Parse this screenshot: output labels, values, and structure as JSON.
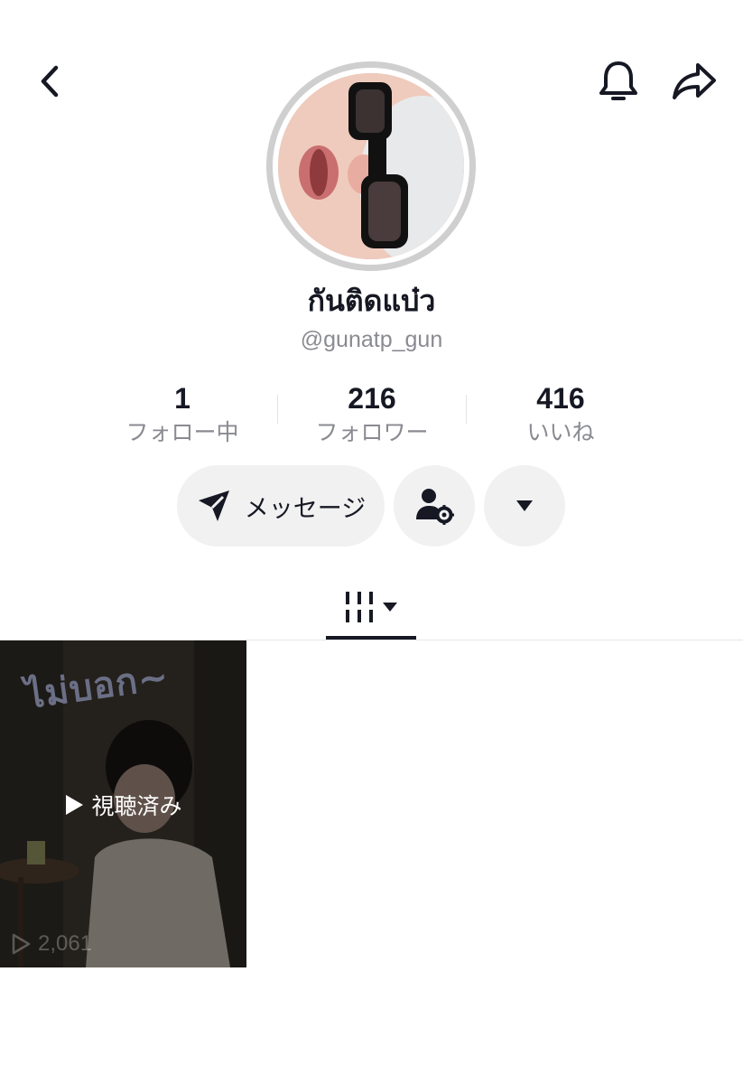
{
  "profile": {
    "display_name": "กันติดแบ๋ว",
    "username": "@gunatp_gun"
  },
  "stats": [
    {
      "value": "1",
      "label": "フォロー中"
    },
    {
      "value": "216",
      "label": "フォロワー"
    },
    {
      "value": "416",
      "label": "いいね"
    }
  ],
  "actions": {
    "message_label": "メッセージ"
  },
  "videos": [
    {
      "sticker_text": "ไม่บอก~",
      "watched_label": "視聴済み",
      "views": "2,061"
    }
  ],
  "icons": {
    "back": "chevron-left-icon",
    "notifications": "bell-icon",
    "share": "share-arrow-icon",
    "message": "send-icon",
    "friends": "user-settings-icon",
    "more": "caret-down-icon",
    "videos_tab": "grid-icon"
  }
}
